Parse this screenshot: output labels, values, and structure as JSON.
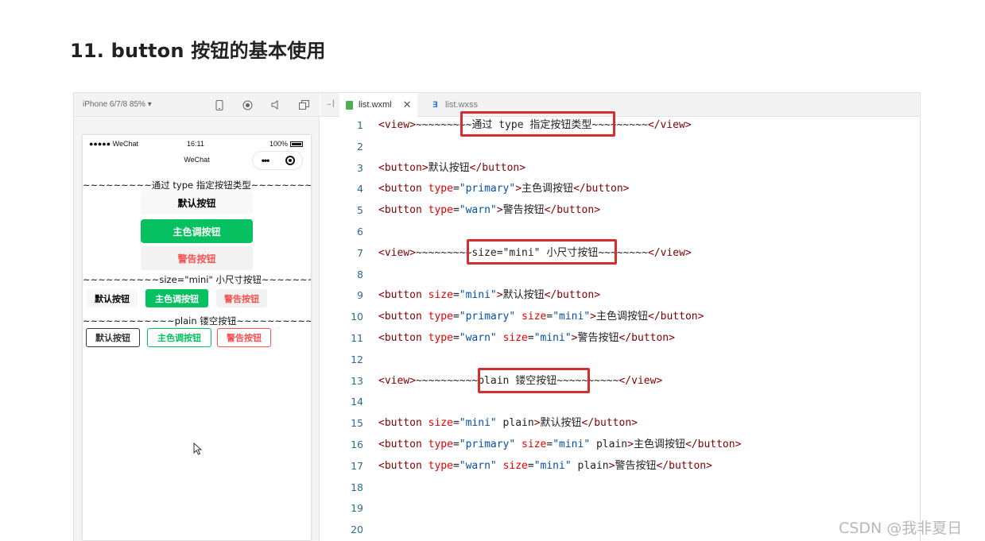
{
  "heading": "11. button 按钮的基本使用",
  "simulator": {
    "device_label": "iPhone 6/7/8 85% ▾",
    "toolbar_icons": [
      "phone-icon",
      "record-icon",
      "volume-icon",
      "window-icon"
    ],
    "status": {
      "signal": "●●●●● WeChat",
      "time": "16:11",
      "battery": "100%"
    },
    "nav_title": "WeChat",
    "capsule_more": "•••",
    "view1": "~~~~~~~~~通过 type 指定按钮类型~~~~~~~~~",
    "view2": "~~~~~~~~~~size=\"mini\" 小尺寸按钮~~~~~~~~~",
    "view3": "~~~~~~~~~~~~plain 镂空按钮~~~~~~~~~~~~",
    "btn_default": "默认按钮",
    "btn_primary": "主色调按钮",
    "btn_warn": "警告按钮",
    "mini_default": "默认按钮",
    "mini_primary": "主色调按钮",
    "mini_warn": "警告按钮",
    "plain_default": "默认按钮",
    "plain_primary": "主色调按钮",
    "plain_warn": "警告按钮"
  },
  "editor": {
    "collapse_icon": "→|",
    "tabs": [
      {
        "label": "list.wxml",
        "close": "✕"
      },
      {
        "label": "list.wxss"
      }
    ],
    "lines": [
      {
        "n": "1",
        "parts": [
          [
            "t",
            "<view>"
          ],
          [
            "tx",
            "~~~~~~~~~通过 type 指定按钮类型~~~~~~~~~"
          ],
          [
            "t",
            "</view>"
          ]
        ]
      },
      {
        "n": "2",
        "parts": []
      },
      {
        "n": "3",
        "parts": [
          [
            "t",
            "<button>"
          ],
          [
            "tx",
            "默认按钮"
          ],
          [
            "t",
            "</button>"
          ]
        ]
      },
      {
        "n": "4",
        "parts": [
          [
            "t",
            "<button "
          ],
          [
            "a",
            "type"
          ],
          [
            "tx",
            "="
          ],
          [
            "v",
            "\"primary\""
          ],
          [
            "t",
            ">"
          ],
          [
            "tx",
            "主色调按钮"
          ],
          [
            "t",
            "</button>"
          ]
        ]
      },
      {
        "n": "5",
        "parts": [
          [
            "t",
            "<button "
          ],
          [
            "a",
            "type"
          ],
          [
            "tx",
            "="
          ],
          [
            "v",
            "\"warn\""
          ],
          [
            "t",
            ">"
          ],
          [
            "tx",
            "警告按钮"
          ],
          [
            "t",
            "</button>"
          ]
        ]
      },
      {
        "n": "6",
        "parts": []
      },
      {
        "n": "7",
        "parts": [
          [
            "t",
            "<view>"
          ],
          [
            "tx",
            "~~~~~~~~~size=\"mini\" 小尺寸按钮~~~~~~~~"
          ],
          [
            "t",
            "</view>"
          ]
        ]
      },
      {
        "n": "8",
        "parts": []
      },
      {
        "n": "9",
        "parts": [
          [
            "t",
            "<button "
          ],
          [
            "a",
            "size"
          ],
          [
            "tx",
            "="
          ],
          [
            "v",
            "\"mini\""
          ],
          [
            "t",
            ">"
          ],
          [
            "tx",
            "默认按钮"
          ],
          [
            "t",
            "</button>"
          ]
        ]
      },
      {
        "n": "10",
        "parts": [
          [
            "t",
            "<button "
          ],
          [
            "a",
            "type"
          ],
          [
            "tx",
            "="
          ],
          [
            "v",
            "\"primary\""
          ],
          [
            "tx",
            " "
          ],
          [
            "a",
            "size"
          ],
          [
            "tx",
            "="
          ],
          [
            "v",
            "\"mini\""
          ],
          [
            "t",
            ">"
          ],
          [
            "tx",
            "主色调按钮"
          ],
          [
            "t",
            "</button>"
          ]
        ]
      },
      {
        "n": "11",
        "parts": [
          [
            "t",
            "<button "
          ],
          [
            "a",
            "type"
          ],
          [
            "tx",
            "="
          ],
          [
            "v",
            "\"warn\""
          ],
          [
            "tx",
            " "
          ],
          [
            "a",
            "size"
          ],
          [
            "tx",
            "="
          ],
          [
            "v",
            "\"mini\""
          ],
          [
            "t",
            ">"
          ],
          [
            "tx",
            "警告按钮"
          ],
          [
            "t",
            "</button>"
          ]
        ]
      },
      {
        "n": "12",
        "parts": []
      },
      {
        "n": "13",
        "parts": [
          [
            "t",
            "<view>"
          ],
          [
            "tx",
            "~~~~~~~~~~plain 镂空按钮~~~~~~~~~~"
          ],
          [
            "t",
            "</view>"
          ]
        ]
      },
      {
        "n": "14",
        "parts": []
      },
      {
        "n": "15",
        "parts": [
          [
            "t",
            "<button "
          ],
          [
            "a",
            "size"
          ],
          [
            "tx",
            "="
          ],
          [
            "v",
            "\"mini\""
          ],
          [
            "tx",
            " plain"
          ],
          [
            "t",
            ">"
          ],
          [
            "tx",
            "默认按钮"
          ],
          [
            "t",
            "</button>"
          ]
        ]
      },
      {
        "n": "16",
        "parts": [
          [
            "t",
            "<button "
          ],
          [
            "a",
            "type"
          ],
          [
            "tx",
            "="
          ],
          [
            "v",
            "\"primary\""
          ],
          [
            "tx",
            " "
          ],
          [
            "a",
            "size"
          ],
          [
            "tx",
            "="
          ],
          [
            "v",
            "\"mini\""
          ],
          [
            "tx",
            " plain"
          ],
          [
            "t",
            ">"
          ],
          [
            "tx",
            "主色调按钮"
          ],
          [
            "t",
            "</button>"
          ]
        ]
      },
      {
        "n": "17",
        "parts": [
          [
            "t",
            "<button "
          ],
          [
            "a",
            "type"
          ],
          [
            "tx",
            "="
          ],
          [
            "v",
            "\"warn\""
          ],
          [
            "tx",
            " "
          ],
          [
            "a",
            "size"
          ],
          [
            "tx",
            "="
          ],
          [
            "v",
            "\"mini\""
          ],
          [
            "tx",
            " plain"
          ],
          [
            "t",
            ">"
          ],
          [
            "tx",
            "警告按钮"
          ],
          [
            "t",
            "</button>"
          ]
        ]
      },
      {
        "n": "18",
        "parts": []
      },
      {
        "n": "19",
        "parts": []
      },
      {
        "n": "20",
        "parts": []
      }
    ]
  },
  "colors": {
    "primary": "#07c160",
    "warn": "#fa5151",
    "highlight": "#d32f2f"
  },
  "watermark": "CSDN @我非夏日"
}
